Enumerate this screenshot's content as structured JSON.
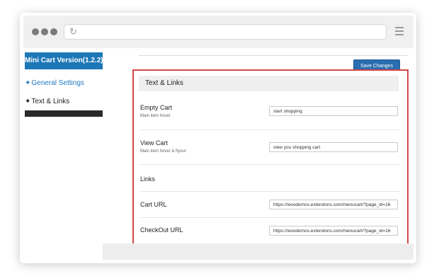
{
  "browser": {
    "reload_icon": "reload-icon",
    "menu_icon": "hamburger-menu-icon"
  },
  "sidebar": {
    "title": "Mini Cart Version(1.2.2)",
    "items": [
      {
        "label": "General Settings",
        "icon": "gear-icon"
      },
      {
        "label": "Text & Links",
        "icon": "gear-icon"
      }
    ]
  },
  "toolbar": {
    "save_label": "Save Changes"
  },
  "panel": {
    "heading": "Text & Links",
    "fields": [
      {
        "label": "Empty Cart",
        "sublabel": "Main item hover",
        "value": "start shopping"
      },
      {
        "label": "View Cart",
        "sublabel": "Main item hover & flyout",
        "value": "view you shopping cart"
      },
      {
        "label": "Links"
      },
      {
        "label": "Cart URL",
        "value": "https://woodemos.extendons.com/menucart/?page_id=16"
      },
      {
        "label": "CheckOut URL",
        "value": "https://woodemos.extendons.com/menucart/?page_id=16"
      }
    ]
  },
  "colors": {
    "accent_blue": "#1d77b7",
    "button_blue": "#2a6db0",
    "highlight_red": "#d34848"
  }
}
